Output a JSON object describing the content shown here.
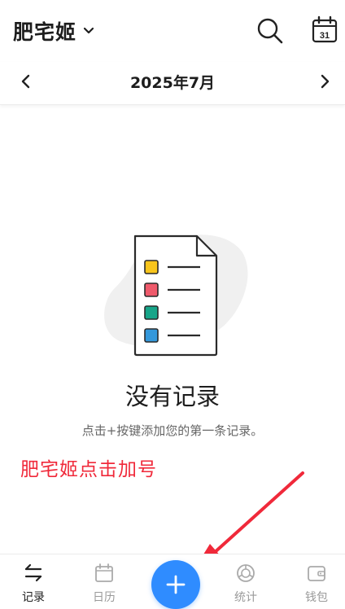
{
  "header": {
    "book_name": "肥宅姬",
    "icons": {
      "dropdown": "chevron-down-icon",
      "search": "search-icon",
      "calendar": "calendar-icon"
    },
    "calendar_day": "31"
  },
  "month_nav": {
    "label": "2025年7月",
    "prev_icon": "chevron-left-icon",
    "next_icon": "chevron-right-icon"
  },
  "empty_state": {
    "title": "没有记录",
    "hint": "点击+按键添加您的第一条记录。",
    "illustration_colors": [
      "#f8c51c",
      "#ef5a6b",
      "#17a589",
      "#3498db"
    ]
  },
  "annotation": {
    "text": "肥宅姬点击加号",
    "color": "#f0293a"
  },
  "bottom_nav": {
    "items": [
      {
        "label": "记录",
        "icon": "records-icon",
        "active": true
      },
      {
        "label": "日历",
        "icon": "calendar-icon",
        "active": false
      },
      {
        "label": "统计",
        "icon": "stats-icon",
        "active": false
      },
      {
        "label": "钱包",
        "icon": "wallet-icon",
        "active": false
      }
    ],
    "add_button": {
      "icon": "plus-icon",
      "color": "#2f8cff"
    }
  }
}
